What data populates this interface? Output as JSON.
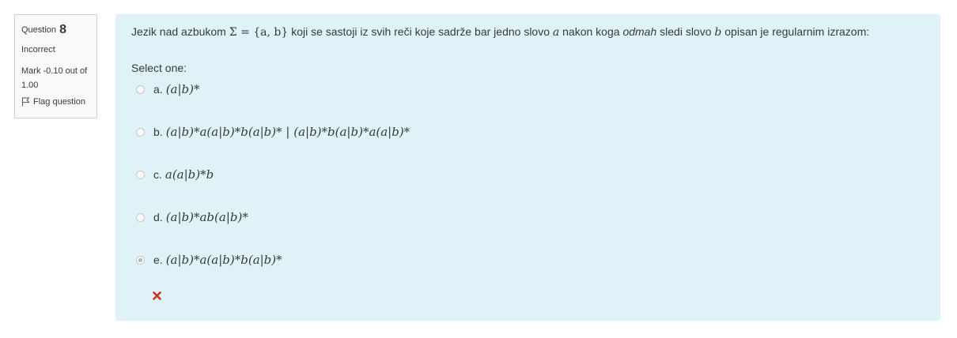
{
  "info": {
    "question_label": "Question",
    "question_number": "8",
    "state": "Incorrect",
    "grade": "Mark -0.10 out of 1.00",
    "flag_label": "Flag question"
  },
  "question": {
    "text_before": "Jezik nad azbukom",
    "sigma_def": "Σ = {a, b}",
    "text_mid1": "koji se sastoji iz svih reči koje sadrže bar jedno slovo",
    "letter_a": "a",
    "text_mid2": "nakon koga",
    "text_emph": "odmah",
    "text_mid3": "sledi slovo",
    "letter_b": "b",
    "text_after": "opisan je regularnim izrazom:",
    "prompt": "Select one:"
  },
  "options": [
    {
      "letter": "a.",
      "expr": "(a|b)*",
      "checked": false
    },
    {
      "letter": "b.",
      "expr": "(a|b)*a(a|b)*b(a|b)* | (a|b)*b(a|b)*a(a|b)*",
      "checked": false
    },
    {
      "letter": "c.",
      "expr": "a(a|b)*b",
      "checked": false
    },
    {
      "letter": "d.",
      "expr": "(a|b)*ab(a|b)*",
      "checked": false
    },
    {
      "letter": "e.",
      "expr": "(a|b)*a(a|b)*b(a|b)*",
      "checked": true
    }
  ],
  "colors": {
    "content_bg": "#def2f8",
    "info_bg": "#f8f9fa",
    "incorrect_icon": "#ca3120"
  },
  "icons": {
    "flag": "flag-icon",
    "feedback": "incorrect-cross-icon"
  }
}
